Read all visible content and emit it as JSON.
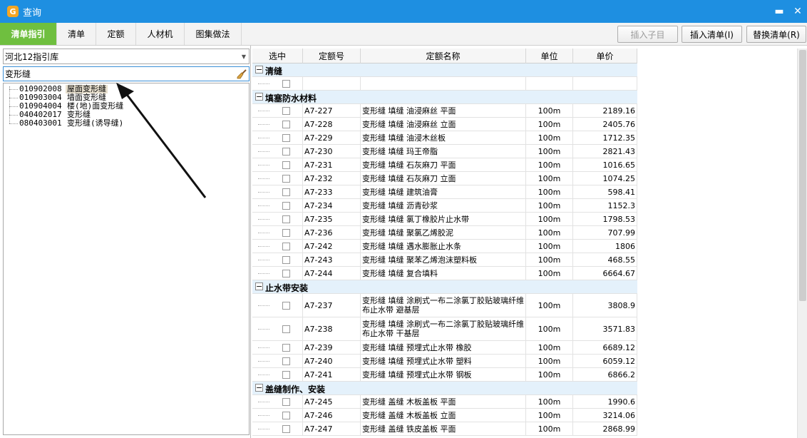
{
  "window": {
    "title": "查询",
    "app_icon_glyph": "G",
    "minimize": "▬",
    "close": "✕"
  },
  "tabs": [
    "清单指引",
    "清单",
    "定额",
    "人材机",
    "图集做法"
  ],
  "toolbar": {
    "insert_child": "插入子目",
    "insert_list": "插入清单(I)",
    "replace_list": "替换清单(R)"
  },
  "left": {
    "library": "河北12指引库",
    "search_value": "变形缝",
    "tree": [
      {
        "code": "010902008",
        "name": "屋面变形缝"
      },
      {
        "code": "010903004",
        "name": "墙面变形缝"
      },
      {
        "code": "010904004",
        "name": "楼(地)面变形缝"
      },
      {
        "code": "040402017",
        "name": "变形缝"
      },
      {
        "code": "080403001",
        "name": "变形缝(诱导缝)"
      }
    ]
  },
  "grid": {
    "columns": [
      "选中",
      "定额号",
      "定额名称",
      "单位",
      "单价"
    ],
    "groups": [
      {
        "name": "清缝",
        "rows": [
          {
            "code": "",
            "name": "",
            "unit": "",
            "price": ""
          }
        ]
      },
      {
        "name": "填塞防水材料",
        "rows": [
          {
            "code": "A7-227",
            "name": "变形缝 填缝 油浸麻丝 平面",
            "unit": "100m",
            "price": "2189.16"
          },
          {
            "code": "A7-228",
            "name": "变形缝 填缝 油浸麻丝 立面",
            "unit": "100m",
            "price": "2405.76"
          },
          {
            "code": "A7-229",
            "name": "变形缝 填缝 油浸木丝板",
            "unit": "100m",
            "price": "1712.35"
          },
          {
            "code": "A7-230",
            "name": "变形缝 填缝 玛王帝脂",
            "unit": "100m",
            "price": "2821.43"
          },
          {
            "code": "A7-231",
            "name": "变形缝 填缝 石灰麻刀 平面",
            "unit": "100m",
            "price": "1016.65"
          },
          {
            "code": "A7-232",
            "name": "变形缝 填缝 石灰麻刀 立面",
            "unit": "100m",
            "price": "1074.25"
          },
          {
            "code": "A7-233",
            "name": "变形缝 填缝 建筑油膏",
            "unit": "100m",
            "price": "598.41"
          },
          {
            "code": "A7-234",
            "name": "变形缝 填缝 沥青砂浆",
            "unit": "100m",
            "price": "1152.3"
          },
          {
            "code": "A7-235",
            "name": "变形缝 填缝 氯丁橡胶片止水带",
            "unit": "100m",
            "price": "1798.53"
          },
          {
            "code": "A7-236",
            "name": "变形缝 填缝 聚氯乙烯胶泥",
            "unit": "100m",
            "price": "707.99"
          },
          {
            "code": "A7-242",
            "name": "变形缝 填缝 遇水膨胀止水条",
            "unit": "100m",
            "price": "1806"
          },
          {
            "code": "A7-243",
            "name": "变形缝 填缝 聚苯乙烯泡沫塑料板",
            "unit": "100m",
            "price": "468.55"
          },
          {
            "code": "A7-244",
            "name": "变形缝 填缝 复合填料",
            "unit": "100m",
            "price": "6664.67"
          }
        ]
      },
      {
        "name": "止水带安装",
        "rows": [
          {
            "code": "A7-237",
            "name": "变形缝 填缝 涂刷式一布二涂氯丁胶贴玻璃纤维布止水带 避基层",
            "unit": "100m",
            "price": "3808.9",
            "tall": true
          },
          {
            "code": "A7-238",
            "name": "变形缝 填缝 涂刷式一布二涂氯丁胶贴玻璃纤维布止水带 干基层",
            "unit": "100m",
            "price": "3571.83",
            "tall": true
          },
          {
            "code": "A7-239",
            "name": "变形缝 填缝 预埋式止水带 橡胶",
            "unit": "100m",
            "price": "6689.12"
          },
          {
            "code": "A7-240",
            "name": "变形缝 填缝 预埋式止水带 塑料",
            "unit": "100m",
            "price": "6059.12"
          },
          {
            "code": "A7-241",
            "name": "变形缝 填缝 预埋式止水带 钢板",
            "unit": "100m",
            "price": "6866.2"
          }
        ]
      },
      {
        "name": "盖缝制作、安装",
        "rows": [
          {
            "code": "A7-245",
            "name": "变形缝 盖缝 木板盖板 平面",
            "unit": "100m",
            "price": "1990.6"
          },
          {
            "code": "A7-246",
            "name": "变形缝 盖缝 木板盖板 立面",
            "unit": "100m",
            "price": "3214.06"
          },
          {
            "code": "A7-247",
            "name": "变形缝 盖缝 铁皮盖板 平面",
            "unit": "100m",
            "price": "2868.99"
          }
        ]
      }
    ],
    "group_toggle": "−"
  },
  "colors": {
    "title_bar": "#1e8fe1",
    "active_tab": "#6fbf3f",
    "group_row": "#e4f1fb"
  }
}
